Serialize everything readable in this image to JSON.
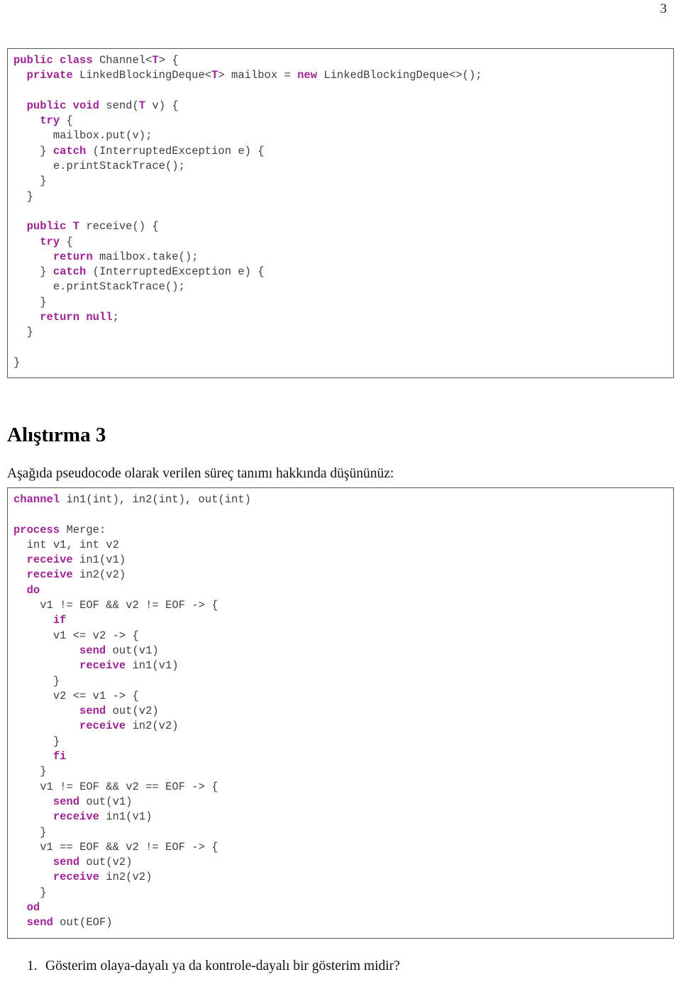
{
  "page": {
    "number": "3"
  },
  "colors": {
    "keyword": "#a02395",
    "code_text": "#3f3f3f",
    "box_border": "#555555",
    "body_text": "#111111"
  },
  "code_block_java": {
    "language": "java",
    "lines": [
      "public class Channel<T> {",
      "  private LinkedBlockingDeque<T> mailbox = new LinkedBlockingDeque<>();",
      "",
      "  public void send(T v) {",
      "    try {",
      "      mailbox.put(v);",
      "    } catch (InterruptedException e) {",
      "      e.printStackTrace();",
      "    }",
      "  }",
      "",
      "  public T receive() {",
      "    try {",
      "      return mailbox.take();",
      "    } catch (InterruptedException e) {",
      "      e.printStackTrace();",
      "    }",
      "    return null;",
      "  }",
      "",
      "}"
    ],
    "keywords": [
      "public",
      "class",
      "private",
      "new",
      "void",
      "try",
      "catch",
      "return",
      "null",
      "T"
    ]
  },
  "heading": {
    "text": "Alıştırma 3"
  },
  "intro_paragraph": {
    "text": "Aşağıda pseudocode olarak verilen süreç tanımı hakkında düşününüz:"
  },
  "code_block_pseudocode": {
    "language": "pseudocode",
    "lines": [
      "channel in1(int), in2(int), out(int)",
      "",
      "process Merge:",
      "  int v1, int v2",
      "  receive in1(v1)",
      "  receive in2(v2)",
      "  do",
      "    v1 != EOF && v2 != EOF -> {",
      "      if",
      "      v1 <= v2 -> {",
      "          send out(v1)",
      "          receive in1(v1)",
      "      }",
      "      v2 <= v1 -> {",
      "          send out(v2)",
      "          receive in2(v2)",
      "      }",
      "      fi",
      "    }",
      "    v1 != EOF && v2 == EOF -> {",
      "      send out(v1)",
      "      receive in1(v1)",
      "    }",
      "    v1 == EOF && v2 != EOF -> {",
      "      send out(v2)",
      "      receive in2(v2)",
      "    }",
      "  od",
      "  send out(EOF)"
    ],
    "keywords": [
      "channel",
      "process",
      "receive",
      "send",
      "do",
      "od",
      "if",
      "fi"
    ]
  },
  "questions": [
    {
      "number": "1.",
      "text": "Gösterim olaya-dayalı ya da kontrole-dayalı bir gösterim midir?"
    }
  ]
}
